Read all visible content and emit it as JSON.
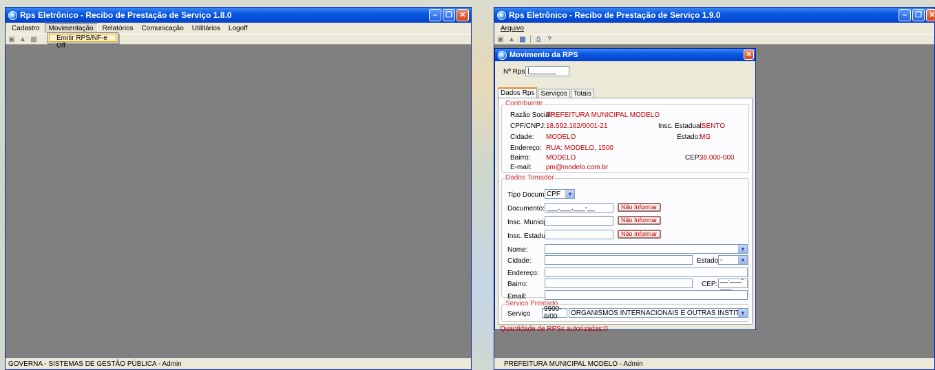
{
  "left_window": {
    "title": "Rps Eletrônico - Recibo de Prestação de Serviço 1.8.0",
    "menu": [
      "Cadastro",
      "Movimentação",
      "Relatórios",
      "Comunicação",
      "Utilitários",
      "Logoff"
    ],
    "dropdown_item": "Emitir RPS/NF-e Off",
    "status": "GOVERNA - SISTEMAS DE GESTÃO PÚBLICA - Admin"
  },
  "right_window": {
    "title": "Rps Eletrônico - Recibo de Prestação de Serviço 1.9.0",
    "menu": [
      "Arquivo"
    ],
    "status": "PREFEITURA MUNICIPAL MODELO - Admin"
  },
  "dialog": {
    "title": "Movimento da RPS",
    "nrps_label": "Nº Rps:",
    "nrps_value": "|_______",
    "tabs": [
      "Dados Rps",
      "Serviços",
      "Totais"
    ],
    "contribuinte": {
      "legend": "Contribuinte",
      "razao_label": "Razão Social:",
      "razao_value": "PREFEITURA MUNICIPAL MODELO",
      "cnpj_label": "CPF/CNPJ:",
      "cnpj_value": "18.592.162/0001-21",
      "ie_label": "Insc. Estadual:",
      "ie_value": "ISENTO",
      "cidade_label": "Cidade:",
      "cidade_value": "MODELO",
      "estado_label": "Estado:",
      "estado_value": "MG",
      "endereco_label": "Endereço:",
      "endereco_value": "RUA: MODELO, 1500",
      "bairro_label": "Bairro:",
      "bairro_value": "MODELO",
      "cep_label": "CEP:",
      "cep_value": "38.000-000",
      "email_label": "E-mail:",
      "email_value": "pm@modelo.com.br"
    },
    "tomador": {
      "legend": "Dados Tomador",
      "tipo_label": "Tipo Docum.:",
      "tipo_value": "CPF",
      "documento_label": "Documento:",
      "documento_value": "___.___.___-__",
      "im_label": "Insc. Municipal:",
      "ie_label": "Insc. Estadual:",
      "nao_informar": "Não Informar",
      "nome_label": "Nome:",
      "cidade_label": "Cidade:",
      "estado_label": "Estado:",
      "estado_value": "-",
      "endereco_label": "Endereço:",
      "bairro_label": "Bairro:",
      "cep_label": "CEP:",
      "cep_value": "__.___-___",
      "email_label": "Email:"
    },
    "servico": {
      "legend": "Servico Prestado",
      "label": "Serviço",
      "code": "9900-8/00",
      "description": "ORGANISMOS INTERNACIONAIS E OUTRAS INSTITUIÇÕES EXTRATERRI"
    },
    "footer_note": "Quantidade de RPSs autorizadas:0"
  }
}
